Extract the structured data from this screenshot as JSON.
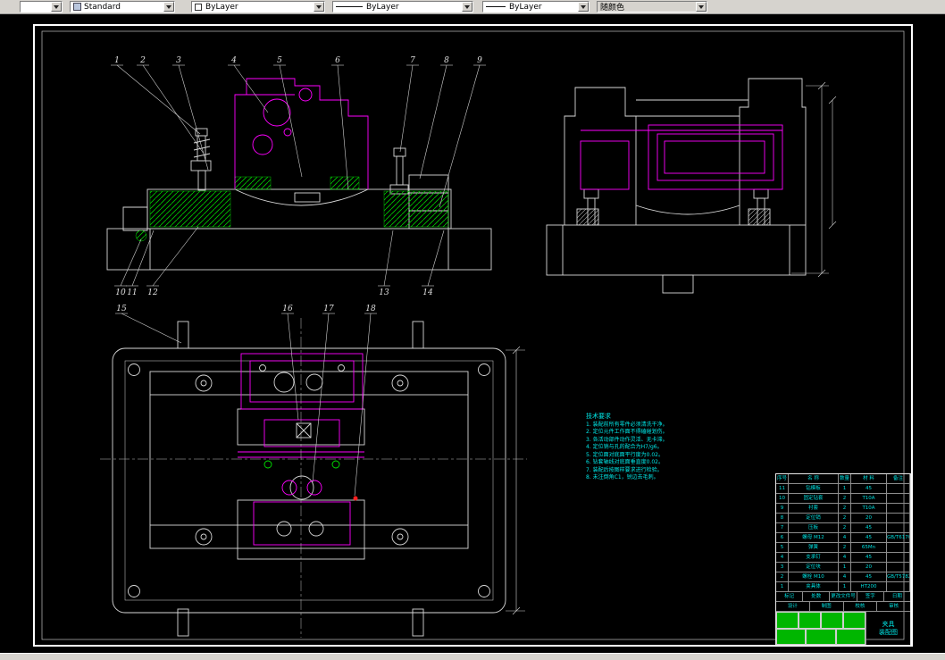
{
  "toolbar": {
    "style": "Standard",
    "color": "ByLayer",
    "linetype": "ByLayer",
    "lineweight": "ByLayer",
    "plot_style": "随颜色"
  },
  "drawing": {
    "callouts": [
      "1",
      "2",
      "3",
      "4",
      "5",
      "6",
      "7",
      "8",
      "9",
      "10",
      "11",
      "12",
      "13",
      "14",
      "15",
      "16",
      "17",
      "18"
    ],
    "notes": {
      "title": "技术要求",
      "lines": [
        "1. 装配前所有零件必须清洗干净。",
        "2. 定位元件工作面不得磕碰划伤。",
        "3. 各活动部件动作灵活、无卡滞。",
        "4. 定位销与孔的配合为H7/g6。",
        "5. 定位面对底面平行度为0.02。",
        "6. 钻套轴线对底面垂直度0.02。",
        "7. 装配后按图样要求进行检验。",
        "8. 未注倒角C1，锐边去毛刺。"
      ]
    }
  },
  "bom": {
    "headers": {
      "no": "序号",
      "name": "名  称",
      "qty": "数量",
      "mat": "材  料",
      "note": "备注"
    },
    "rows": [
      {
        "no": "11",
        "name": "钻模板",
        "qty": "1",
        "mat": "45",
        "note": ""
      },
      {
        "no": "10",
        "name": "固定钻套",
        "qty": "2",
        "mat": "T10A",
        "note": ""
      },
      {
        "no": "9",
        "name": "衬套",
        "qty": "2",
        "mat": "T10A",
        "note": ""
      },
      {
        "no": "8",
        "name": "定位销",
        "qty": "2",
        "mat": "20",
        "note": ""
      },
      {
        "no": "7",
        "name": "压板",
        "qty": "2",
        "mat": "45",
        "note": ""
      },
      {
        "no": "6",
        "name": "螺母 M12",
        "qty": "4",
        "mat": "45",
        "note": "GB/T6170"
      },
      {
        "no": "5",
        "name": "弹簧",
        "qty": "2",
        "mat": "65Mn",
        "note": ""
      },
      {
        "no": "4",
        "name": "支承钉",
        "qty": "4",
        "mat": "45",
        "note": ""
      },
      {
        "no": "3",
        "name": "定位块",
        "qty": "1",
        "mat": "20",
        "note": ""
      },
      {
        "no": "2",
        "name": "螺栓 M10",
        "qty": "4",
        "mat": "45",
        "note": "GB/T5782"
      },
      {
        "no": "1",
        "name": "夹具体",
        "qty": "1",
        "mat": "HT200",
        "note": ""
      }
    ]
  },
  "title_block": {
    "row1": [
      "标记",
      "处数",
      "更改文件号",
      "签字",
      "日期"
    ],
    "row2": [
      "设计",
      "制图",
      "校核",
      "审核"
    ],
    "title_line1": "夹具",
    "title_line2": "装配图"
  },
  "colors": {
    "line": "#FFFFFF",
    "workpiece": "#FF00FF",
    "hatch": "#00CC00",
    "annotation": "#00FFFF"
  }
}
